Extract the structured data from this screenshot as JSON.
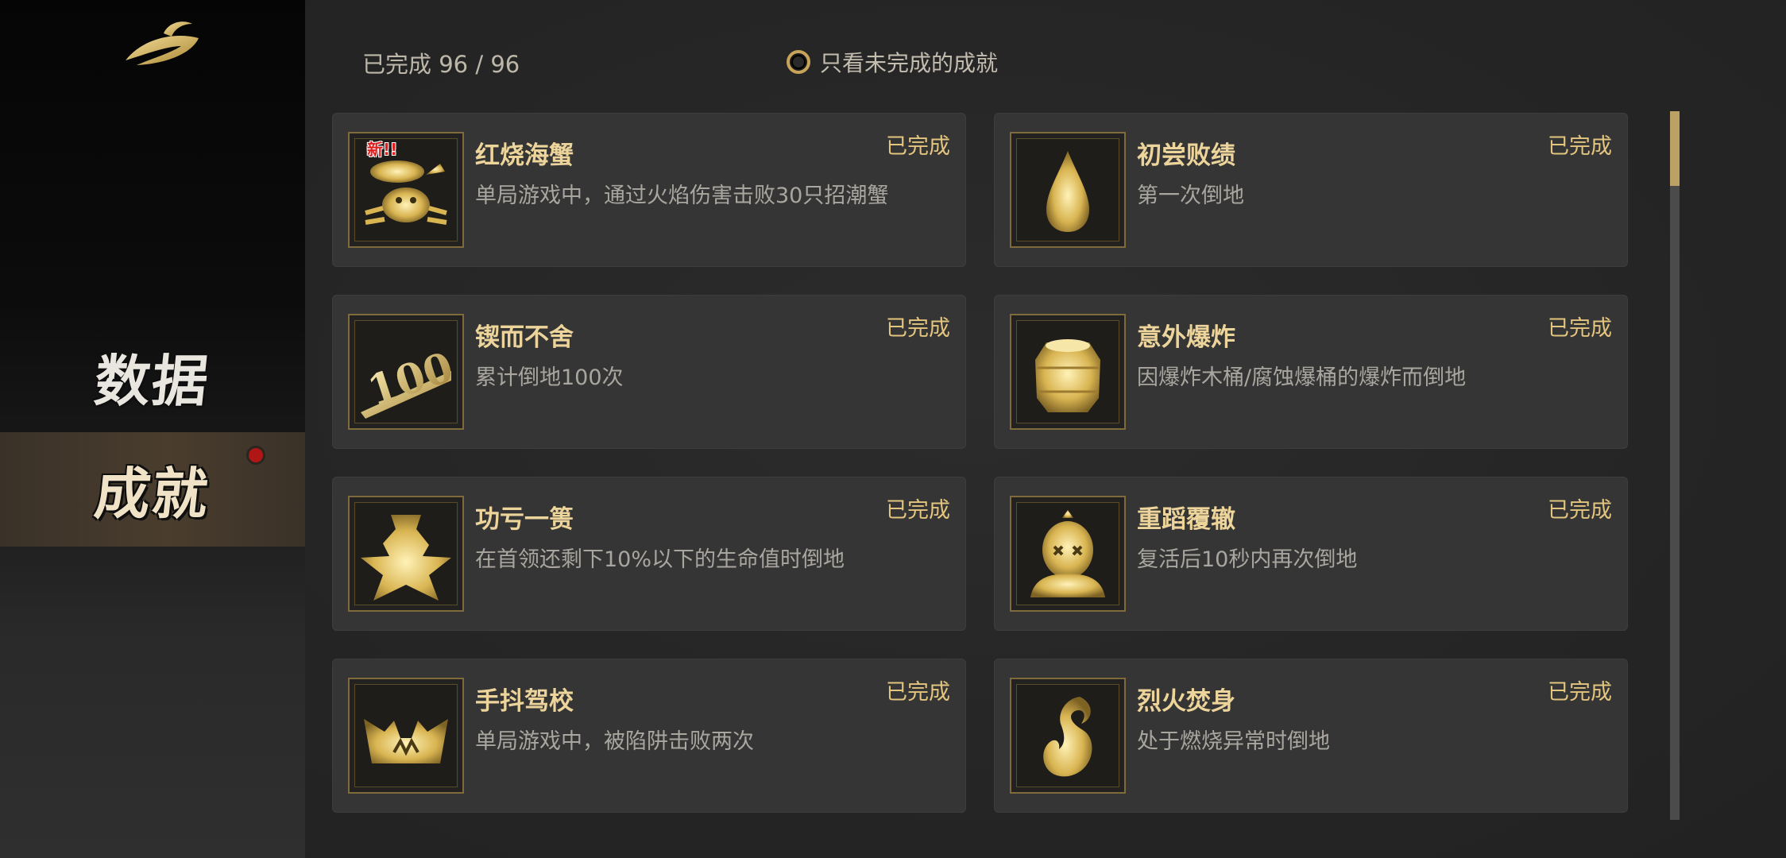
{
  "sidebar": {
    "nav": [
      {
        "label": "数据"
      },
      {
        "label": "成就"
      }
    ]
  },
  "header": {
    "progress": "已完成 96 / 96",
    "filter_label": "只看未完成的成就"
  },
  "achievements": [
    {
      "title": "红烧海蟹",
      "desc": "单局游戏中，通过火焰伤害击败30只招潮蟹",
      "status": "已完成",
      "icon": "crab-icon",
      "badge": "新!!"
    },
    {
      "title": "初尝败绩",
      "desc": "第一次倒地",
      "status": "已完成",
      "icon": "teardrop-icon"
    },
    {
      "title": "锲而不舍",
      "desc": "累计倒地100次",
      "status": "已完成",
      "icon": "hundred-icon"
    },
    {
      "title": "意外爆炸",
      "desc": "因爆炸木桶/腐蚀爆桶的爆炸而倒地",
      "status": "已完成",
      "icon": "barrel-icon"
    },
    {
      "title": "功亏一篑",
      "desc": "在首领还剩下10%以下的生命值时倒地",
      "status": "已完成",
      "icon": "broken-vase-icon"
    },
    {
      "title": "重蹈覆辙",
      "desc": "复活后10秒内再次倒地",
      "status": "已完成",
      "icon": "knocked-out-head-icon"
    },
    {
      "title": "手抖驾校",
      "desc": "单局游戏中，被陷阱击败两次",
      "status": "已完成",
      "icon": "trap-icon"
    },
    {
      "title": "烈火焚身",
      "desc": "处于燃烧异常时倒地",
      "status": "已完成",
      "icon": "flame-icon"
    }
  ],
  "colors": {
    "accent_gold": "#e3c57e",
    "title_gold": "#ecd49a",
    "alert_red": "#b01616"
  }
}
